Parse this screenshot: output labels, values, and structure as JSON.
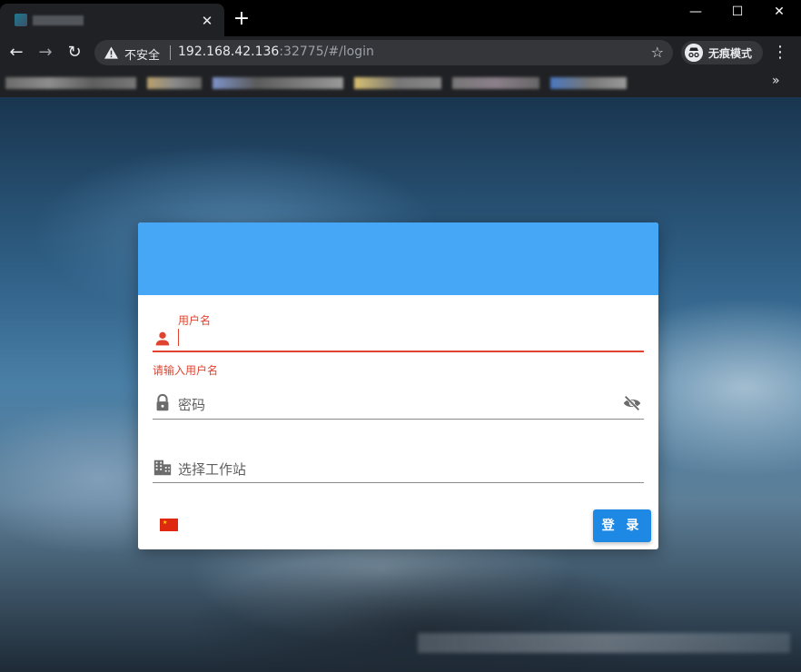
{
  "browser": {
    "window_controls": {
      "minimize": "—",
      "maximize": "☐",
      "close": "✕"
    },
    "tab": {
      "close": "✕"
    },
    "new_tab": "+",
    "nav": {
      "back": "←",
      "forward": "→",
      "reload": "↻"
    },
    "omnibox": {
      "security_label": "不安全",
      "url_host": "192.168.42.136",
      "url_rest": ":32775/#/login",
      "bookmark_star": "☆"
    },
    "incognito_label": "无痕模式",
    "menu": "⋮",
    "bookmarks_more": "»"
  },
  "login": {
    "username": {
      "label": "用户名",
      "value": "",
      "error": "请输入用户名",
      "icon": "person-icon"
    },
    "password": {
      "placeholder": "密码",
      "icon": "lock-icon",
      "toggle_icon": "eye-off-icon"
    },
    "workstation": {
      "placeholder": "选择工作站",
      "icon": "building-icon"
    },
    "language_flag": "china-flag-icon",
    "submit_label": "登 录"
  },
  "colors": {
    "header": "#45a7f5",
    "error": "#e0432f",
    "button": "#1e88e5"
  }
}
